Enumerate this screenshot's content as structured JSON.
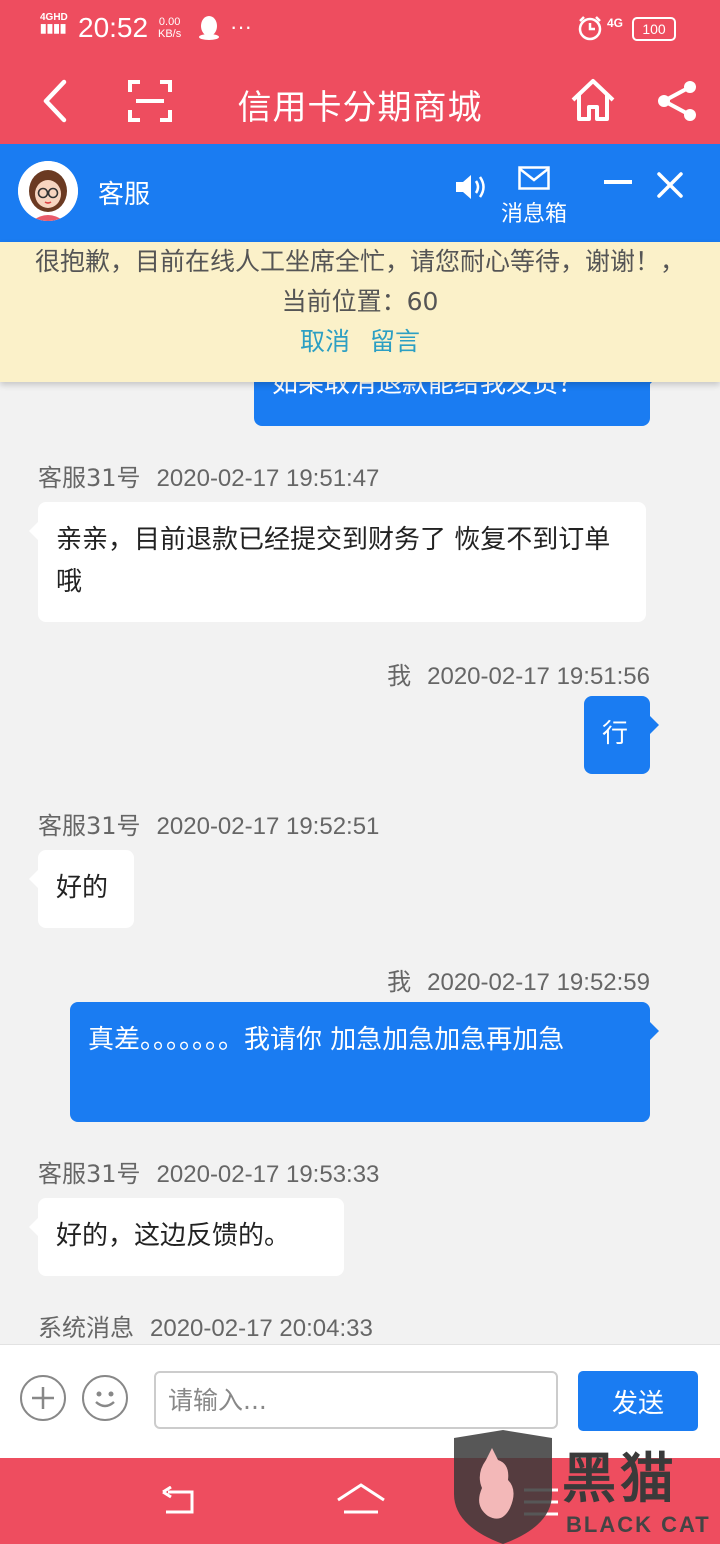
{
  "status_bar": {
    "network": "4GHD",
    "time": "20:52",
    "speed_value": "0.00",
    "speed_unit": "KB/s",
    "more": "···",
    "signal_right": "4G",
    "battery": "100"
  },
  "title_bar": {
    "title": "信用卡分期商城",
    "icons": [
      "back-arrow-icon",
      "scan-icon",
      "home-icon",
      "share-icon"
    ]
  },
  "cs_header": {
    "name": "客服",
    "inbox_label": "消息箱",
    "icons": [
      "avatar",
      "speaker-icon",
      "mail-icon",
      "minimize-icon",
      "close-icon"
    ]
  },
  "notice": {
    "text": "很抱歉，目前在线人工坐席全忙，请您耐心等待，谢谢！，当前位置：60",
    "cancel": "取消",
    "leave_message": "留言"
  },
  "messages": [
    {
      "id": "m0",
      "from": "me",
      "text": "如果取消退款能给我发货？"
    },
    {
      "id": "m1",
      "from": "agent",
      "sender": "客服31号",
      "time": "2020-02-17 19:51:47",
      "text": "亲亲，目前退款已经提交到财务了 恢复不到订单哦"
    },
    {
      "id": "m2",
      "from": "me",
      "sender": "我",
      "time": "2020-02-17 19:51:56",
      "text": "行"
    },
    {
      "id": "m3",
      "from": "agent",
      "sender": "客服31号",
      "time": "2020-02-17 19:52:51",
      "text": "好的"
    },
    {
      "id": "m4",
      "from": "me",
      "sender": "我",
      "time": "2020-02-17 19:52:59",
      "text": "真差。。。。。。。我请你 加急加急加急再加急"
    },
    {
      "id": "m5",
      "from": "agent",
      "sender": "客服31号",
      "time": "2020-02-17 19:53:33",
      "text": "好的，这边反馈的。"
    },
    {
      "id": "m6",
      "from": "system",
      "sender": "系统消息",
      "time": "2020-02-17 20:04:33"
    }
  ],
  "input_bar": {
    "placeholder": "请输入...",
    "send": "发送",
    "icons": [
      "add-icon",
      "emoji-icon"
    ]
  },
  "nav_bar": {
    "icons": [
      "nav-back-icon",
      "nav-home-icon",
      "nav-menu-icon"
    ]
  },
  "watermark": {
    "title": "黑猫",
    "subtitle": "BLACK CAT"
  },
  "colors": {
    "brand_red": "#ee4d5f",
    "chat_blue": "#1a7cf2",
    "notice_bg": "#fbf1c9",
    "link_teal": "#2c9fc3"
  }
}
